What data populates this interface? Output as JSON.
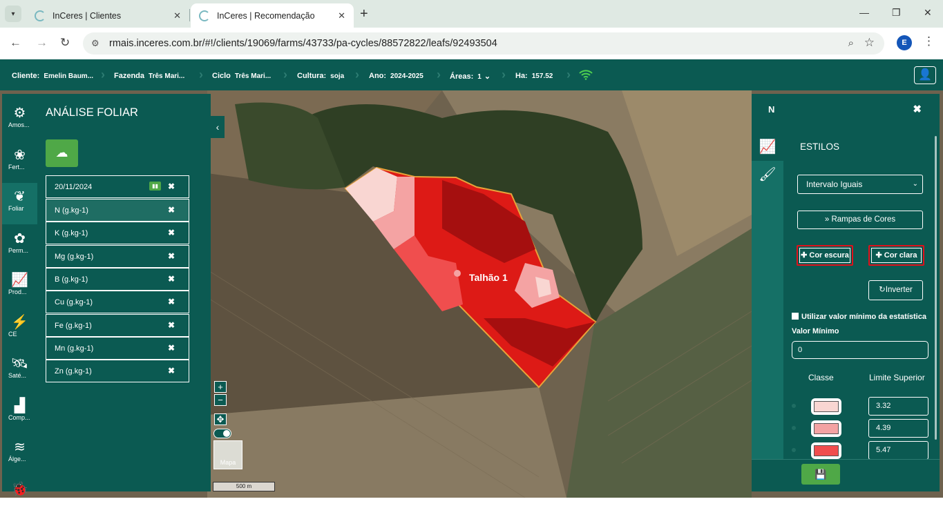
{
  "browser": {
    "tabs": [
      {
        "title": "InCeres | Clientes"
      },
      {
        "title": "InCeres | Recomendação"
      }
    ],
    "url": "rmais.inceres.com.br/#!/clients/19069/farms/43733/pa-cycles/88572822/leafs/92493504",
    "profile_initial": "E"
  },
  "header": {
    "cliente_label": "Cliente:",
    "cliente_value": "Emelin Baum...",
    "fazenda_label": "Fazenda",
    "fazenda_value": "Três Mari...",
    "ciclo_label": "Ciclo",
    "ciclo_value": "Três Mari...",
    "cultura_label": "Cultura:",
    "cultura_value": "soja",
    "ano_label": "Ano:",
    "ano_value": "2024-2025",
    "areas_label": "Áreas:",
    "areas_value": "1",
    "ha_label": "Ha:",
    "ha_value": "157.52"
  },
  "rail": [
    {
      "label": "Amos...",
      "icon": "sampling-icon"
    },
    {
      "label": "Fert...",
      "icon": "fertility-icon"
    },
    {
      "label": "Foliar",
      "icon": "leaf-icon",
      "active": true
    },
    {
      "label": "Perm...",
      "icon": "plant-icon"
    },
    {
      "label": "Prod...",
      "icon": "chart-line-icon"
    },
    {
      "label": "CE",
      "icon": "ce-icon"
    },
    {
      "label": "Saté...",
      "icon": "satellite-icon"
    },
    {
      "label": "Comp...",
      "icon": "compaction-icon"
    },
    {
      "label": "Álge...",
      "icon": "layers-icon"
    },
    {
      "label": "",
      "icon": "bug-icon"
    }
  ],
  "panel": {
    "title": "ANÁLISE FOLIAR",
    "date": "20/11/2024",
    "items": [
      "N (g.kg-1)",
      "K (g.kg-1)",
      "Mg (g.kg-1)",
      "B (g.kg-1)",
      "Cu (g.kg-1)",
      "Fe (g.kg-1)",
      "Mn (g.kg-1)",
      "Zn (g.kg-1)"
    ]
  },
  "map": {
    "field_label": "Talhão 1",
    "thumb_label": "Mapa",
    "scale_label": "500 m"
  },
  "right_panel": {
    "title": "N",
    "section": "ESTILOS",
    "method": "Intervalo Iguais",
    "ramp_button": "Rampas de Cores",
    "dark_button": "Cor escura",
    "light_button": "Cor clara",
    "invert_button": "Inverter",
    "use_min_label": "Utilizar valor mínimo da estatística",
    "min_label": "Valor Mínimo",
    "min_value": "0",
    "col_class": "Classe",
    "col_limit": "Limite Superior",
    "classes": [
      {
        "color": "#f9d6d2",
        "limit": "3.32"
      },
      {
        "color": "#f4a3a3",
        "limit": "4.39"
      },
      {
        "color": "#f04e4e",
        "limit": "5.47"
      }
    ]
  },
  "colors": {
    "brand": "#0b5a52",
    "accent_green": "#4fa847",
    "highlight": "#e0101a"
  }
}
